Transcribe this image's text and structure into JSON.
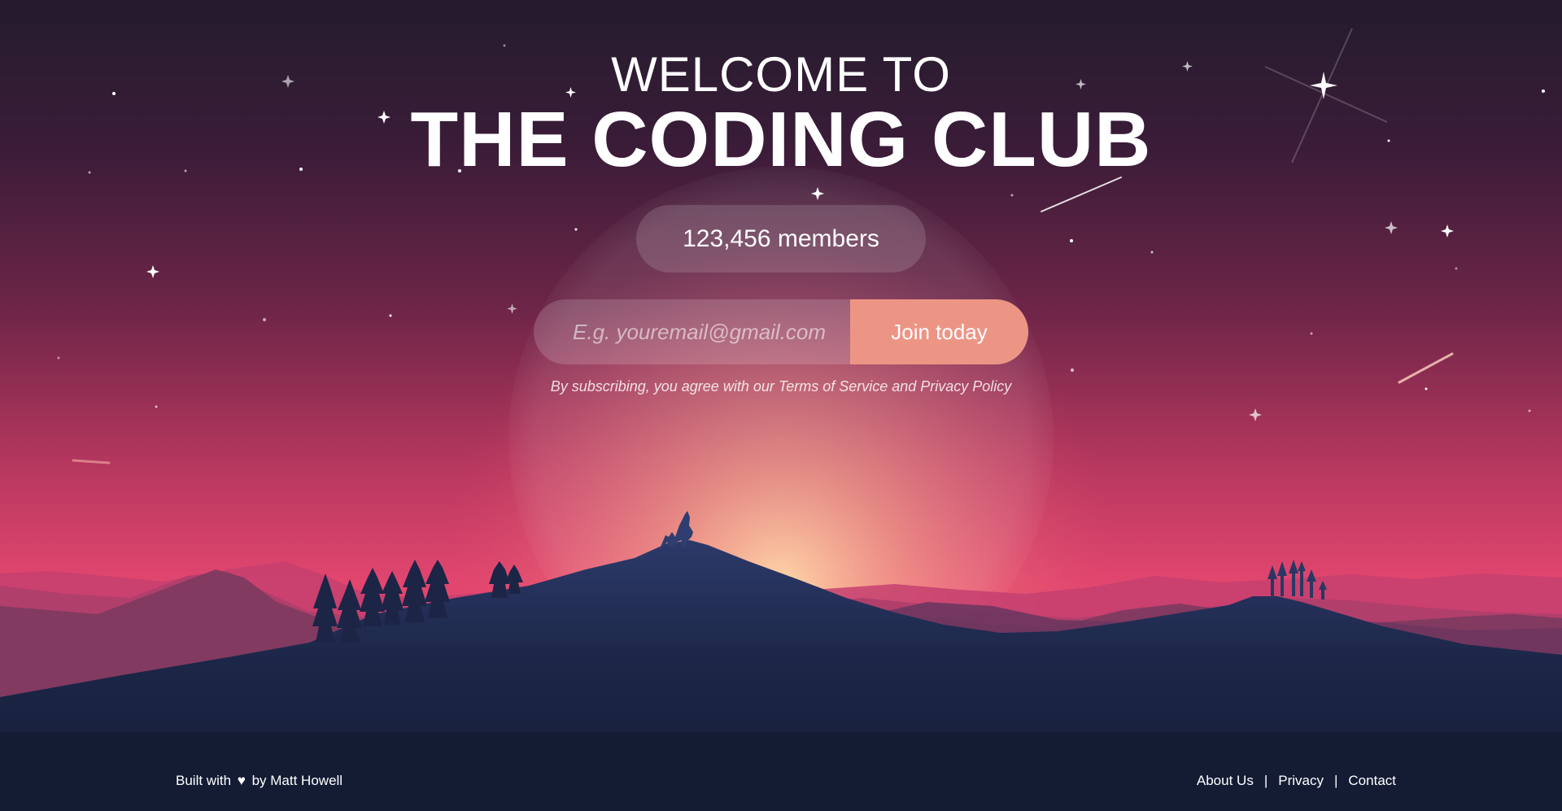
{
  "hero": {
    "welcome": "WELCOME TO",
    "title": "THE CODING CLUB",
    "members": "123,456 members"
  },
  "signup": {
    "email_placeholder": "E.g. youremail@gmail.com",
    "join_label": "Join today",
    "terms": "By subscribing, you agree with our Terms of Service and Privacy Policy"
  },
  "footer": {
    "built_with": "Built with",
    "heart_icon": "heart-icon",
    "by": "by Matt Howell",
    "links": [
      "About Us",
      "Privacy",
      "Contact"
    ],
    "separator": "|"
  },
  "colors": {
    "sky_top": "#251b2e",
    "sky_mid": "#8a2d55",
    "sky_horizon": "#e0446f",
    "glow": "#f6b48b",
    "mountain_front": "#1b2445",
    "mountain_dark": "#141c34",
    "button": "#ed9585"
  }
}
